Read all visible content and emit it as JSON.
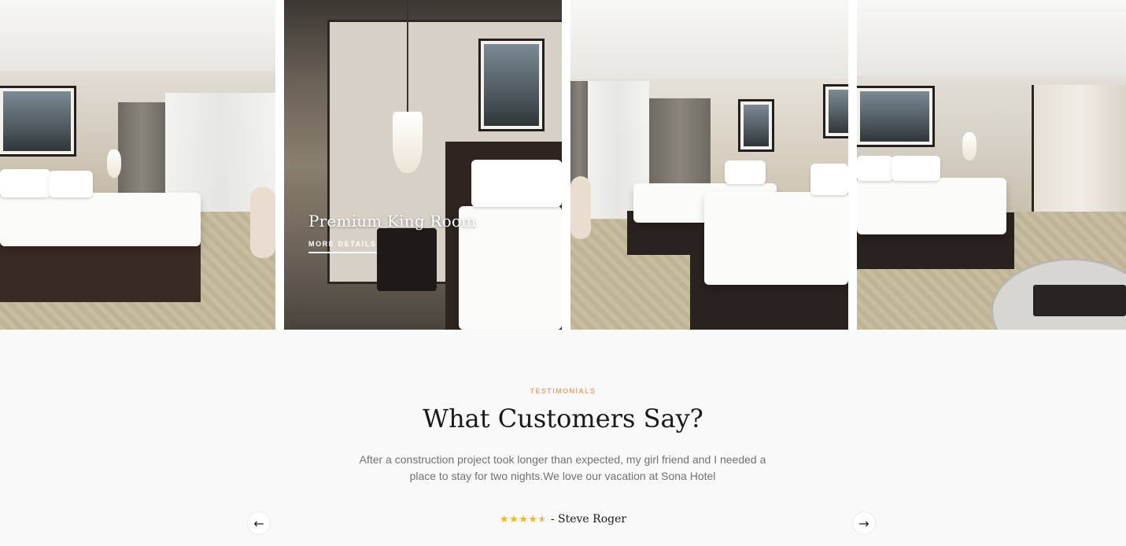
{
  "rooms": [
    {
      "image": "hotel-room-double-bed-window"
    },
    {
      "image": "hotel-room-king-bed-pendant-lamp",
      "title": "Premium King Room",
      "link_label": "MORE DETAILS"
    },
    {
      "image": "hotel-room-twin-beds"
    },
    {
      "image": "hotel-room-bed-with-bathroom"
    }
  ],
  "testimonials": {
    "label": "TESTIMONIALS",
    "title": "What Customers Say?",
    "quote": "After a construction project took longer than expected, my girl friend and I needed a place to stay for two nights.We love our vacation at Sona Hotel",
    "rating": 4.5,
    "rating_max": 5,
    "reviewer": "- Steve Roger",
    "prev_icon": "arrow-left-icon",
    "next_icon": "arrow-right-icon"
  },
  "colors": {
    "accent": "#dfa974",
    "star": "#f5b917",
    "heading": "#19191a",
    "body_text": "#707079"
  }
}
